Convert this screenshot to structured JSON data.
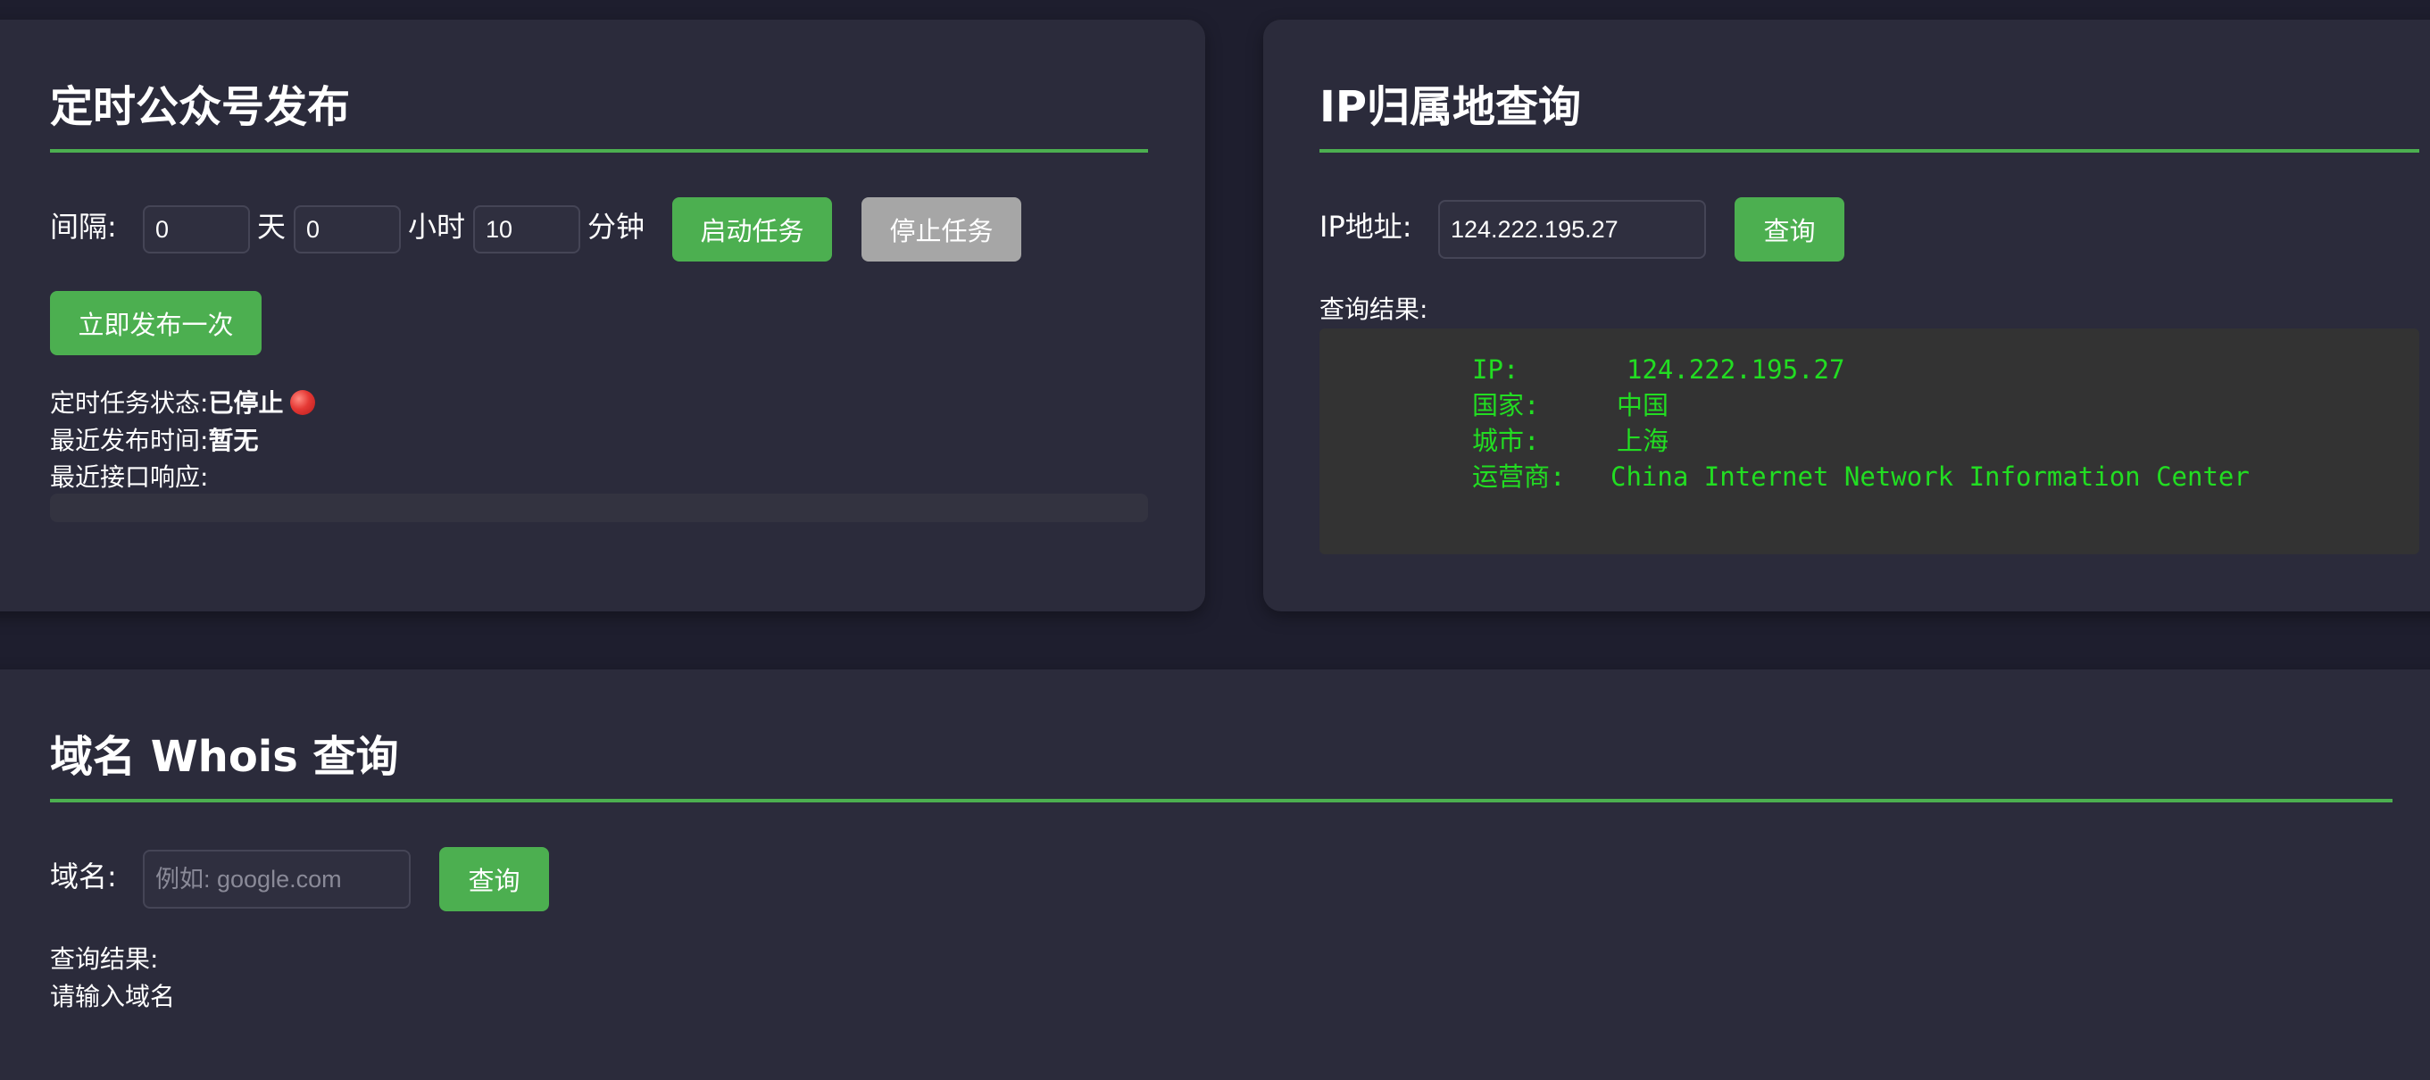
{
  "schedule": {
    "title": "定时公众号发布",
    "interval_label": "间隔:",
    "days_value": "0",
    "days_unit": "天",
    "hours_value": "0",
    "hours_unit": "小时",
    "minutes_value": "10",
    "minutes_unit": "分钟",
    "start_button": "启动任务",
    "stop_button": "停止任务",
    "publish_now_button": "立即发布一次",
    "status_label": "定时任务状态:",
    "status_value": "已停止",
    "status_icon": "red-circle-icon",
    "last_publish_label": "最近发布时间:",
    "last_publish_value": "暂无",
    "last_response_label": "最近接口响应:",
    "last_response_value": ""
  },
  "ip": {
    "title": "IP归属地查询",
    "address_label": "IP地址:",
    "address_value": "124.222.195.27",
    "query_button": "查询",
    "result_label": "查询结果:",
    "result": {
      "ip_label": "IP:",
      "ip_value": "124.222.195.27",
      "country_label": "国家:",
      "country_value": "中国",
      "city_label": "城市:",
      "city_value": "上海",
      "isp_label": "运营商:",
      "isp_value": "China Internet Network Information Center"
    }
  },
  "whois": {
    "title": "域名 Whois 查询",
    "domain_label": "域名:",
    "domain_placeholder": "例如: google.com",
    "domain_value": "",
    "query_button": "查询",
    "result_label": "查询结果:",
    "result_text": "请输入域名"
  },
  "colors": {
    "accent": "#4caf50",
    "background": "#1e1e2e",
    "card": "#2b2b3b",
    "result_text": "#22dd22",
    "stop_button": "#a6a6a6"
  }
}
